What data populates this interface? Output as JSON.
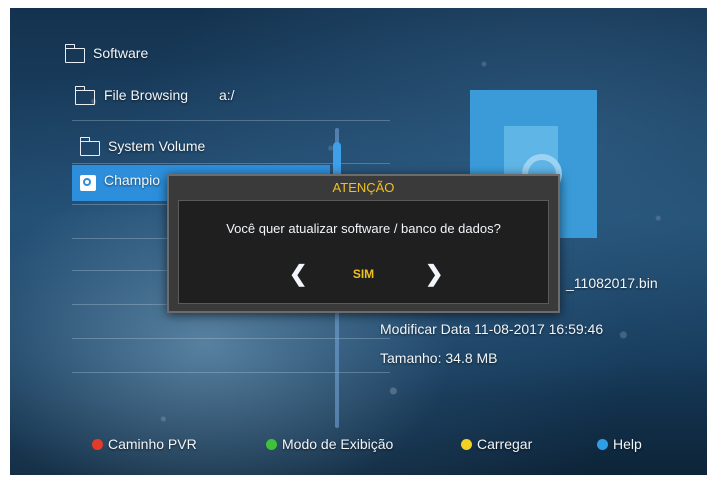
{
  "browser": {
    "root_label": "Software",
    "current_folder_label": "File Browsing",
    "path": "a:/",
    "items": [
      {
        "label": "System Volume"
      },
      {
        "label": "Champio"
      }
    ]
  },
  "file_info": {
    "file_name_fragment": "_11082017.bin",
    "modified_label": "Modificar Data",
    "modified_value": "11-08-2017 16:59:46",
    "size_label": "Tamanho",
    "size_value": "34.8 MB"
  },
  "dialog": {
    "title": "ATENÇÃO",
    "message": "Você quer atualizar software / banco de dados?",
    "option": "SIM",
    "left_arrow": "❮",
    "right_arrow": "❯"
  },
  "footer": [
    {
      "label": "Caminho PVR",
      "color": "#e23b2a"
    },
    {
      "label": "Modo de Exibição",
      "color": "#3fc23a"
    },
    {
      "label": "Carregar",
      "color": "#f2d21c"
    },
    {
      "label": "Help",
      "color": "#2f9ee8"
    }
  ],
  "colors": {
    "selection": "#2d8fdc",
    "dialog_title": "#f0c020",
    "option_text": "#f0c020"
  }
}
